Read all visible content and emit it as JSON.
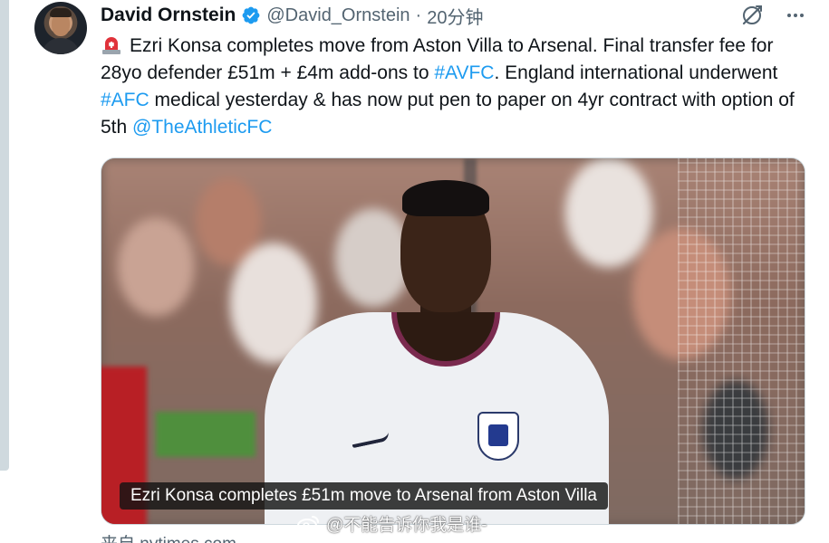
{
  "author": {
    "display_name": "David Ornstein",
    "handle": "@David_Ornstein",
    "separator": "·",
    "time": "20分钟"
  },
  "tweet": {
    "emoji": "siren-emoji",
    "parts": [
      {
        "type": "text",
        "value": "Ezri Konsa completes move from Aston Villa to Arsenal. Final transfer fee for 28yo defender £51m + £4m add-ons to "
      },
      {
        "type": "link",
        "value": "#AVFC"
      },
      {
        "type": "text",
        "value": ". England international underwent "
      },
      {
        "type": "link",
        "value": "#AFC"
      },
      {
        "type": "text",
        "value": " medical yesterday & has now put pen to paper on 4yr contract with option of 5th "
      },
      {
        "type": "link",
        "value": "@TheAthleticFC"
      }
    ]
  },
  "media": {
    "caption": "Ezri Konsa completes £51m move to Arsenal from Aston Villa"
  },
  "watermark": {
    "text": "@不能告诉你我是谁-"
  },
  "source": {
    "text": "来自 nytimes.com"
  },
  "icons": {
    "verified": "verified-badge-icon",
    "grok": "grok-icon",
    "more": "more-icon"
  },
  "colors": {
    "link": "#1d9bf0",
    "muted": "#536471",
    "verified": "#1d9bf0"
  }
}
